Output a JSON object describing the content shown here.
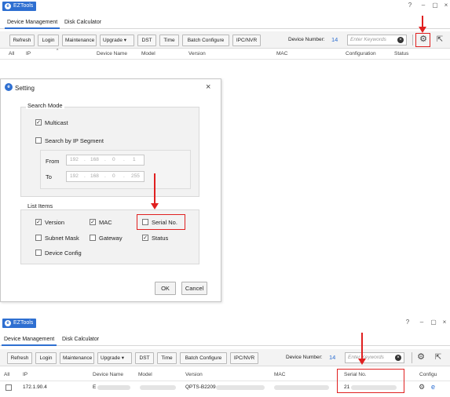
{
  "app": {
    "title": "EZTools"
  },
  "tabs": [
    "Device Management",
    "Disk Calculator"
  ],
  "toolbar": {
    "buttons": [
      "Refresh",
      "Login",
      "Maintenance",
      "Upgrade",
      "DST",
      "Time",
      "Batch Configure",
      "IPC/NVR"
    ],
    "device_number_label": "Device Number:",
    "device_number_value": "14",
    "search_placeholder": "Enter Keywords"
  },
  "columns_top": [
    "All",
    "IP",
    "Device Name",
    "Model",
    "Version",
    "MAC",
    "Configuration",
    "Status"
  ],
  "dialog": {
    "title": "Setting",
    "search_mode": {
      "label": "Search Mode",
      "multicast": "Multicast",
      "by_ip_segment": "Search by IP Segment",
      "from_label": "From",
      "to_label": "To",
      "from_ip": [
        "192",
        "168",
        "0",
        "1"
      ],
      "to_ip": [
        "192",
        "168",
        "0",
        "255"
      ]
    },
    "list_items": {
      "label": "List Items",
      "version": "Version",
      "mac": "MAC",
      "serial_no": "Serial No.",
      "subnet_mask": "Subnet Mask",
      "gateway": "Gateway",
      "status": "Status",
      "device_config": "Device Config"
    },
    "ok": "OK",
    "cancel": "Cancel"
  },
  "columns_bottom": [
    "All",
    "IP",
    "Device Name",
    "Model",
    "Version",
    "MAC",
    "Serial No.",
    "Configu"
  ],
  "row": {
    "ip": "172.1.90.4",
    "device_name": "E",
    "version": "QPTS-B2209",
    "serial": "21"
  },
  "colors": {
    "accent": "#2e6fd1",
    "highlight": "#e02020"
  }
}
